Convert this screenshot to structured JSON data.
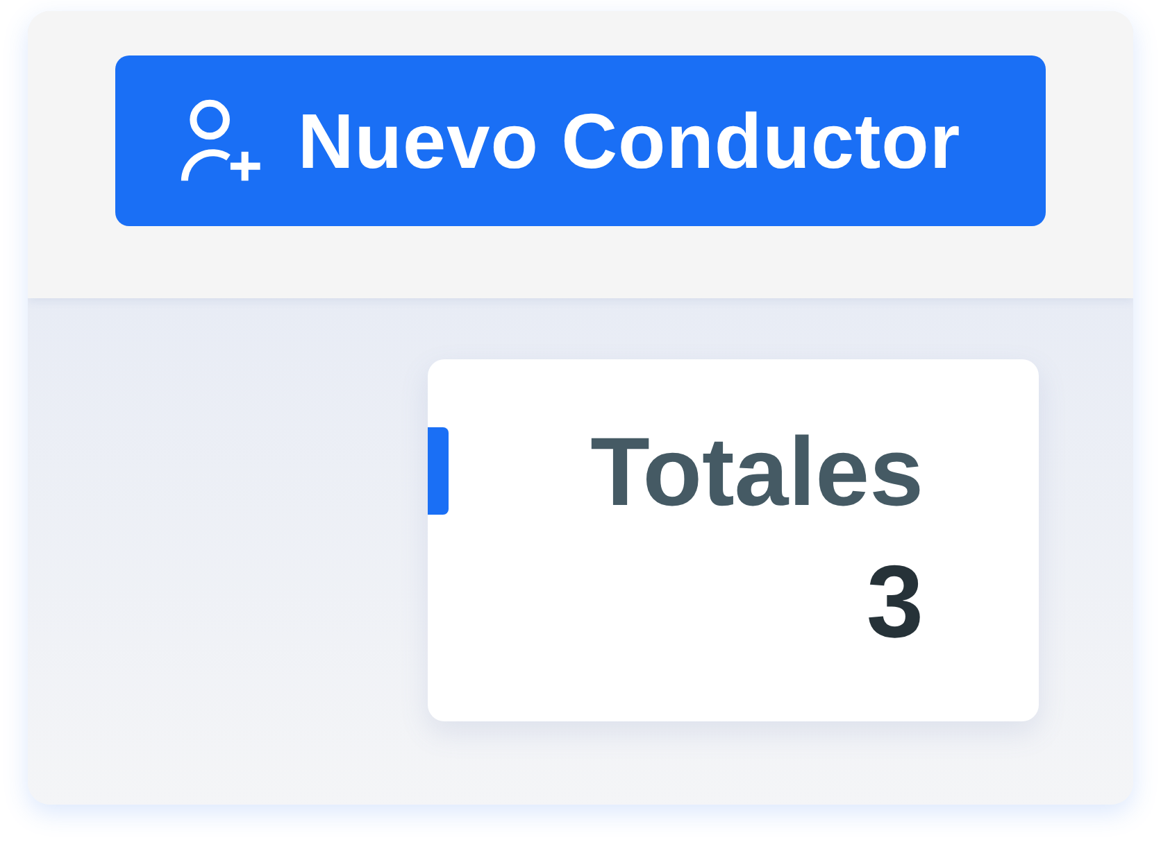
{
  "toolbar": {
    "button": {
      "label": "Nuevo Conductor"
    }
  },
  "summary_card": {
    "title": "Totales",
    "value": "3"
  }
}
